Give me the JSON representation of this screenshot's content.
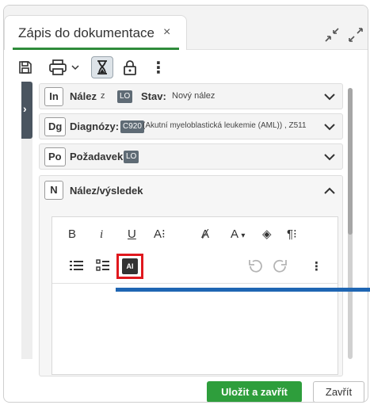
{
  "tab": {
    "title": "Zápis do dokumentace",
    "close_symbol": "×"
  },
  "window_controls": {
    "collapse_icon": "collapse-arrows-icon",
    "expand_icon": "expand-arrows-icon"
  },
  "toolbar": {
    "icons": [
      "save-icon",
      "print-icon",
      "chevron-down-icon",
      "hourglass-icon",
      "lock-icon",
      "more-vertical-icon"
    ],
    "more_symbol": "⋮"
  },
  "sidebar_toggle": {
    "symbol": "›"
  },
  "sections": [
    {
      "code": "In",
      "label": "Nález",
      "small": "z",
      "badge": "LO",
      "status_label": "Stav:",
      "status_value": "Nový nález"
    },
    {
      "code": "Dg",
      "label": "Diagnózy:",
      "badge": "C920",
      "detail": "(Akutní myeloblastická leukemie (AML)) , Z511"
    },
    {
      "code": "Po",
      "label": "Požadavek",
      "badge": "LO"
    },
    {
      "code": "N",
      "label": "Nález/výsledek",
      "expanded": true
    }
  ],
  "editor_toolbar": {
    "bold": "B",
    "italic": "i",
    "underline": "U",
    "text_size": "A⁝",
    "clear_format": "Ⱥ",
    "font_color": "A",
    "font_color_caret": "▾",
    "highlight": "◈",
    "paragraph": "¶⁝",
    "more": "⋮",
    "ai_label": "AI",
    "highlight_color": "#e0181e"
  },
  "annotation_color": "#1f66b3",
  "footer": {
    "save_label": "Uložit a zavřít",
    "close_label": "Zavřít"
  },
  "colors": {
    "accent": "#2e8b3a",
    "save_button": "#2e9e3c",
    "badge": "#5f6b75"
  }
}
